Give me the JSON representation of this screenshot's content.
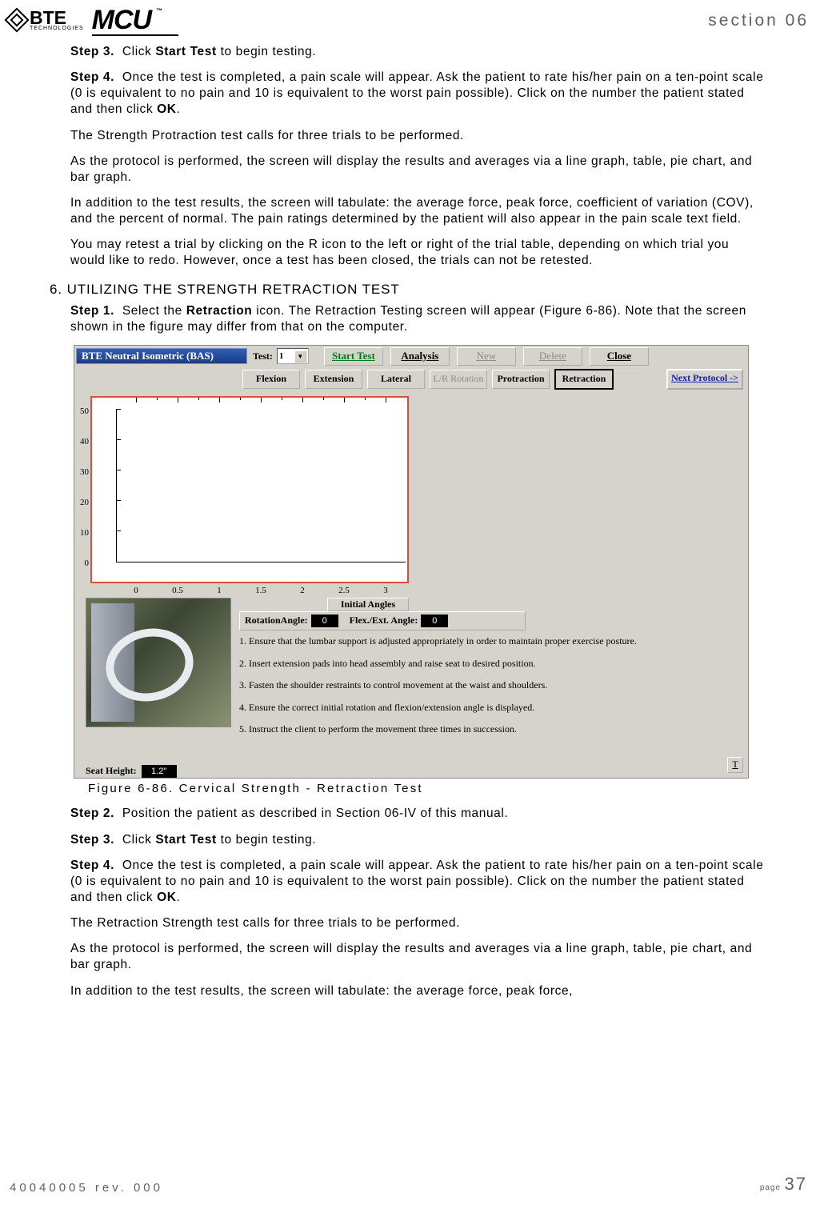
{
  "header": {
    "bte_big": "BTE",
    "bte_small": "TECHNOLOGIES",
    "mcu": "MCU",
    "tm": "™",
    "section_label": "section 06"
  },
  "top_block": {
    "s3_prefix": "Step 3.",
    "s3_body_pre": "Click ",
    "s3_bold": "Start Test",
    "s3_body_post": " to begin testing.",
    "s4_prefix": "Step 4.",
    "s4_body_pre": "Once the test is completed, a pain scale will appear. Ask the patient to rate his/her pain on a ten-point scale (0 is equivalent to no pain and 10 is equivalent to the worst pain possible). Click on the number the patient stated and then click ",
    "s4_bold": "OK",
    "s4_post": ".",
    "p1": "The Strength Protraction test calls for three trials to be performed.",
    "p2": "As the protocol is performed, the screen will display the results and averages via a line graph, table, pie chart, and bar graph.",
    "p3": "In addition to the test results, the screen will tabulate: the average force, peak force, coefficient of variation (COV), and the percent of normal. The pain ratings determined by the patient will also appear in the pain scale text field.",
    "p4": "You may retest a trial by clicking on the R icon to the left or right of the trial table, depending on which trial you would like to redo. However, once a test has been closed, the trials can not be retested."
  },
  "subhead": "6. UTILIZING THE STRENGTH RETRACTION TEST",
  "step1": {
    "prefix": "Step 1.",
    "body_pre": "Select the ",
    "bold": "Retraction",
    "body_post": " icon. The Retraction Testing screen will appear (Figure 6-86).  Note that the screen shown in the figure may differ from that on the computer."
  },
  "app": {
    "title": "BTE Neutral Isometric (BAS)",
    "test_label": "Test:",
    "test_value": "1",
    "btn_start": "Start Test",
    "btn_analysis": "Analysis",
    "btn_new": "New",
    "btn_delete": "Delete",
    "btn_close": "Close",
    "tabs": [
      "Flexion",
      "Extension",
      "Lateral",
      "L/R Rotation",
      "Protraction",
      "Retraction"
    ],
    "next_protocol": "Next Protocol ->",
    "initial_angles_title": "Initial Angles",
    "rot_label": "RotationAngle:",
    "rot_value": "0",
    "flex_label": "Flex./Ext. Angle:",
    "flex_value": "0",
    "instr": [
      "1.  Ensure that the lumbar support is adjusted appropriately in order to maintain proper exercise posture.",
      "2.  Insert extension pads into head assembly and raise seat to desired position.",
      "3.  Fasten the shoulder restraints to control movement at the waist and shoulders.",
      "4.  Ensure the correct initial rotation and flexion/extension angle is displayed.",
      "5.  Instruct the client to perform the movement three times in succession."
    ],
    "seat_label": "Seat Height:",
    "seat_value": "1.2\"",
    "t_icon": "T"
  },
  "chart_data": {
    "type": "line",
    "title": "",
    "categories": [
      0,
      0.5,
      1,
      1.5,
      2,
      2.5,
      3
    ],
    "series": [],
    "y_ticks": [
      0,
      10,
      20,
      30,
      40,
      50
    ],
    "x_ticks": [
      0,
      0.5,
      1,
      1.5,
      2,
      2.5,
      3
    ],
    "xlabel": "",
    "ylabel": "",
    "xlim": [
      -0.25,
      3.25
    ],
    "ylim": [
      0,
      50
    ]
  },
  "fig_caption": "Figure 6-86. Cervical Strength - Retraction Test",
  "bottom_block": {
    "s2_prefix": "Step 2.",
    "s2_body": "Position the patient as described in Section 06-IV of this manual.",
    "s3_prefix": "Step 3.",
    "s3_pre": "Click ",
    "s3_bold": "Start Test",
    "s3_post": " to begin testing.",
    "s4_prefix": "Step 4.",
    "s4_pre": "Once the test is completed, a pain scale will appear. Ask the patient to rate his/her pain on a ten-point scale (0 is equivalent to no pain and 10 is equivalent to the worst pain possible). Click on the number the patient stated and then click ",
    "s4_bold": "OK",
    "s4_post": ".",
    "p1": "The Retraction Strength test calls for three trials to be performed.",
    "p2": "As the protocol is performed, the screen will display the results and averages via a line graph, table, pie chart, and bar graph.",
    "p3": "In addition to the test results, the screen will tabulate: the average force, peak force,"
  },
  "footer": {
    "docid": "40040005 rev. 000",
    "page_label": "page",
    "page_num": "37"
  }
}
